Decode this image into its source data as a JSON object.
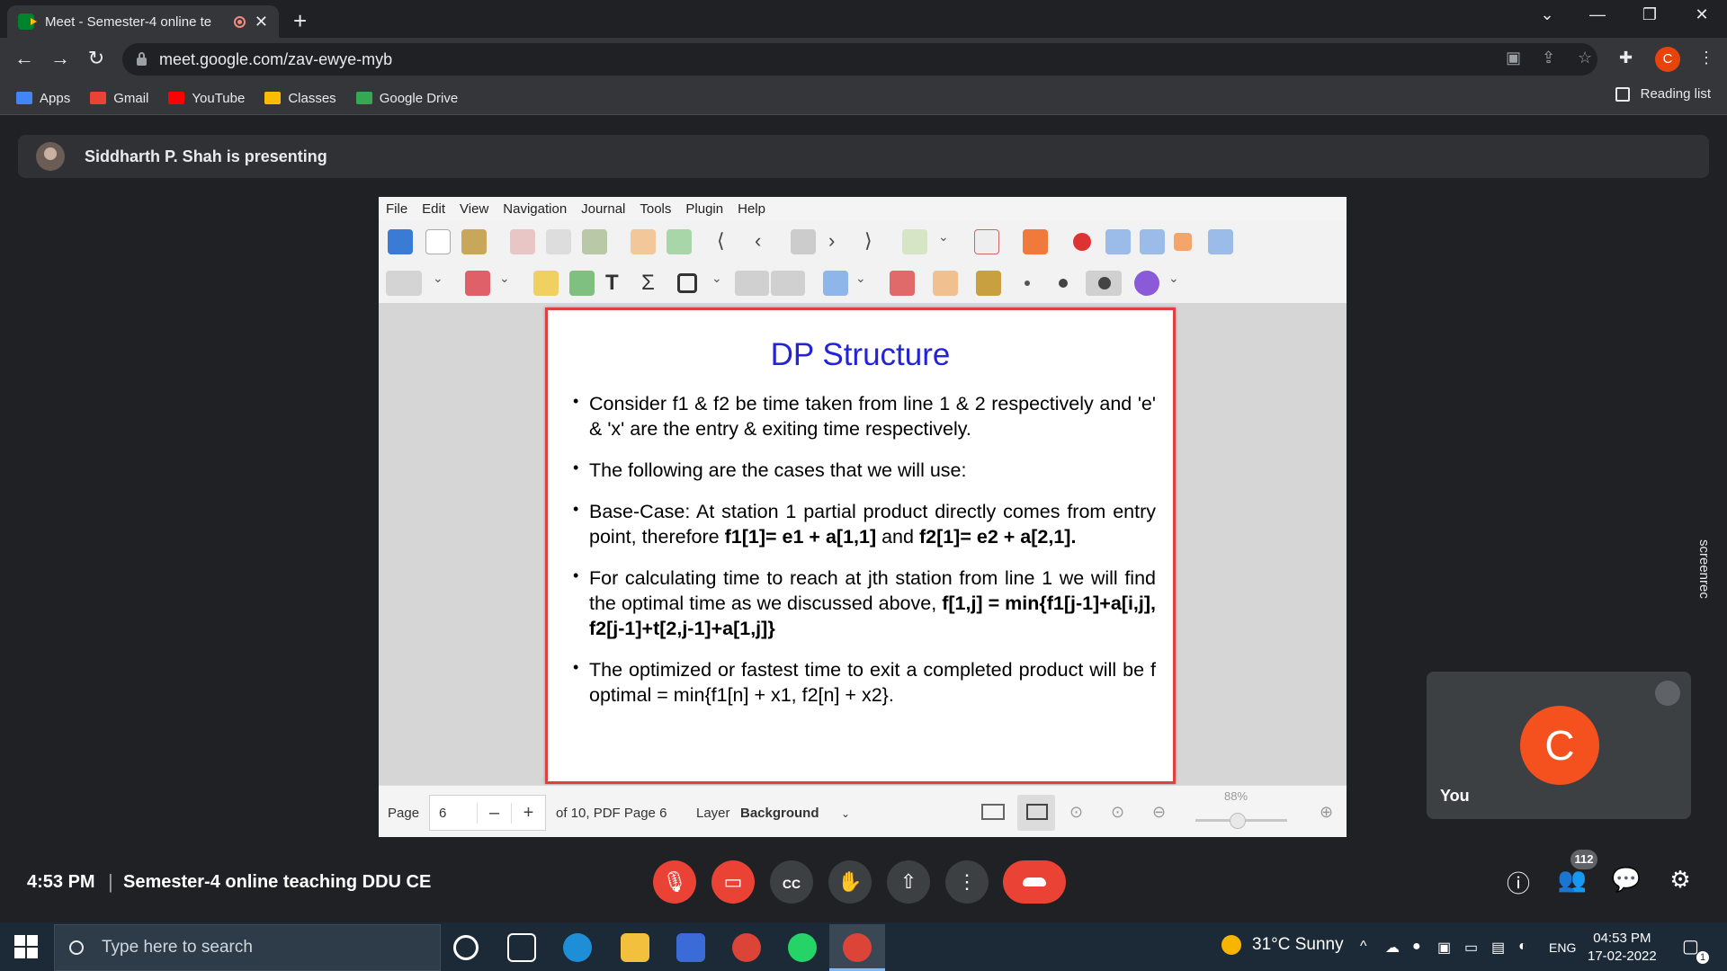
{
  "browser": {
    "tab_title": "Meet - Semester-4 online te",
    "url": "meet.google.com/zav-ewye-myb",
    "profile_initial": "C",
    "bookmarks": [
      {
        "label": "Apps",
        "color": "#4285f4"
      },
      {
        "label": "Gmail",
        "color": "#ea4335"
      },
      {
        "label": "YouTube",
        "color": "#ff0000"
      },
      {
        "label": "Classes",
        "color": "#fbbc04"
      },
      {
        "label": "Google Drive",
        "color": "#34a853"
      }
    ],
    "reading_list": "Reading list"
  },
  "meet": {
    "presenting_banner": "Siddharth P. Shah is presenting",
    "time": "4:53 PM",
    "separator": "|",
    "meeting_name": "Semester-4 online teaching DDU CE",
    "participant_count": "112",
    "self_tile": {
      "initial": "C",
      "label": "You"
    },
    "screenrec_label": "screenrec"
  },
  "xournal": {
    "menu": [
      "File",
      "Edit",
      "View",
      "Navigation",
      "Journal",
      "Tools",
      "Plugin",
      "Help"
    ],
    "status": {
      "page_label": "Page",
      "page_value": "6",
      "minus": "–",
      "plus": "+",
      "page_of": "of 10, PDF Page 6",
      "layer_label": "Layer",
      "layer_value": "Background",
      "zoom": "88%"
    }
  },
  "slide": {
    "title": "DP Structure",
    "b1": "Consider f1 & f2 be time taken from line 1 & 2 respectively and 'e' & 'x' are the entry & exiting time respectively.",
    "b2": "The following are the cases that we will use:",
    "b3_a": "Base-Case: At station 1 partial product directly comes from entry point, therefore ",
    "b3_b": "f1[1]= e1 + a[1,1]",
    "b3_c": " and ",
    "b3_d": "f2[1]= e2 + a[2,1].",
    "b4_a": "For calculating time to reach at jth station from line 1 we will find the optimal time as we discussed above, ",
    "b4_b": "f[1,j] = min{f1[j-1]+a[i,j], f2[j-1]+t[2,j-1]+a[1,j]}",
    "b5": "The optimized or fastest time to exit a completed product will be f optimal = min{f1[n] + x1, f2[n] + x2}."
  },
  "taskbar": {
    "search_placeholder": "Type here to search",
    "weather": "31°C  Sunny",
    "lang": "ENG",
    "clock_time": "04:53 PM",
    "clock_date": "17-02-2022",
    "notif_count": "1"
  }
}
